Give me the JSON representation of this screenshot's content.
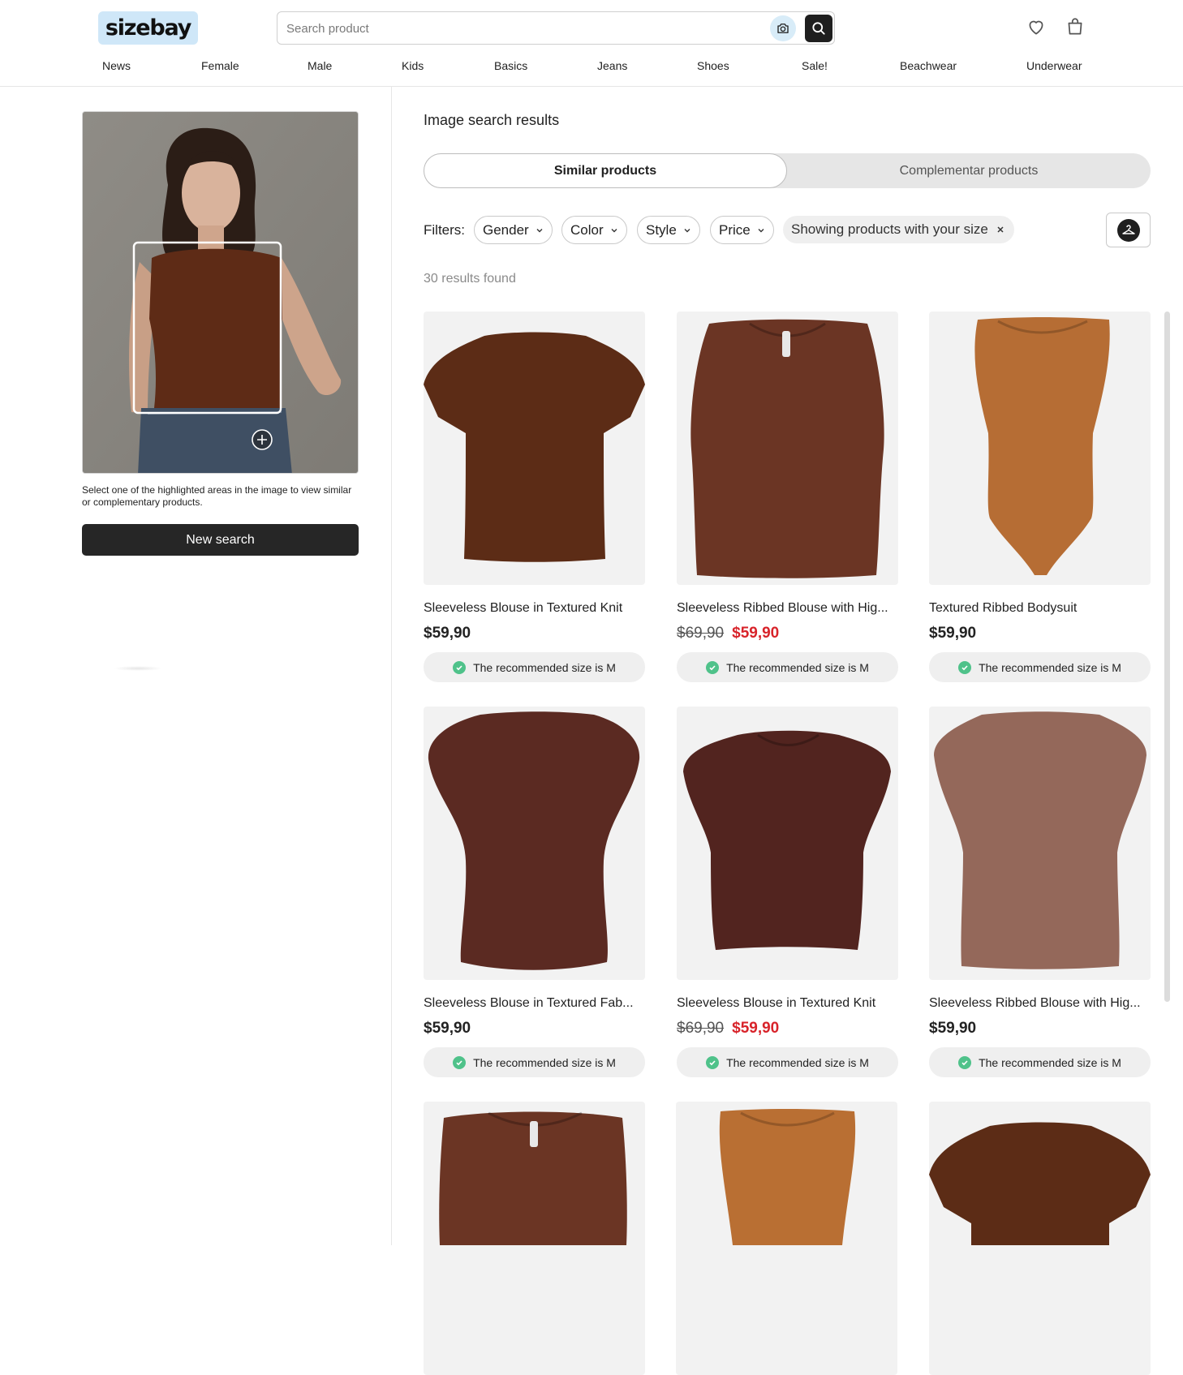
{
  "header": {
    "logo": "sizebay",
    "search_placeholder": "Search product",
    "icons": {
      "camera": "camera-icon",
      "search": "search-icon",
      "wishlist": "heart-icon",
      "bag": "shopping-bag-icon"
    }
  },
  "nav": [
    "News",
    "Female",
    "Male",
    "Kids",
    "Basics",
    "Jeans",
    "Shoes",
    "Sale!",
    "Beachwear",
    "Underwear"
  ],
  "left": {
    "hint": "Select one of the highlighted areas in the image to view similar or complementary products.",
    "new_search": "New search"
  },
  "main": {
    "title": "Image search results",
    "tabs": [
      {
        "label": "Similar products",
        "active": true
      },
      {
        "label": "Complementar products",
        "active": false
      }
    ],
    "filters_label": "Filters:",
    "filters": [
      "Gender",
      "Color",
      "Style",
      "Price"
    ],
    "size_filter": "Showing products with your size",
    "results_count": "30 results found",
    "rec_text": "The recommended size is",
    "rec_size": "M",
    "products": [
      {
        "name": "Sleeveless Blouse in Textured Knit",
        "old_price": "",
        "price": "$59,90",
        "color": "#5c2c16"
      },
      {
        "name": "Sleeveless Ribbed Blouse with Hig...",
        "old_price": "$69,90",
        "price": "$59,90",
        "color": "#6b3524"
      },
      {
        "name": "Textured Ribbed Bodysuit",
        "old_price": "",
        "price": "$59,90",
        "color": "#b66d34"
      },
      {
        "name": "Sleeveless Blouse in Textured Fab...",
        "old_price": "",
        "price": "$59,90",
        "color": "#5b2a22"
      },
      {
        "name": "Sleeveless Blouse in Textured Knit",
        "old_price": "$69,90",
        "price": "$59,90",
        "color": "#52241f"
      },
      {
        "name": "Sleeveless Ribbed Blouse with Hig...",
        "old_price": "",
        "price": "$59,90",
        "color": "#94685a"
      },
      {
        "name": "",
        "old_price": "",
        "price": "",
        "color": "#6b3524"
      },
      {
        "name": "",
        "old_price": "",
        "price": "",
        "color": "#b96f33"
      },
      {
        "name": "",
        "old_price": "",
        "price": "",
        "color": "#5c2c16"
      }
    ]
  },
  "colors": {
    "accent": "#cfe7f8",
    "sale": "#d8232a",
    "check": "#4fc28a",
    "dark": "#262626"
  }
}
